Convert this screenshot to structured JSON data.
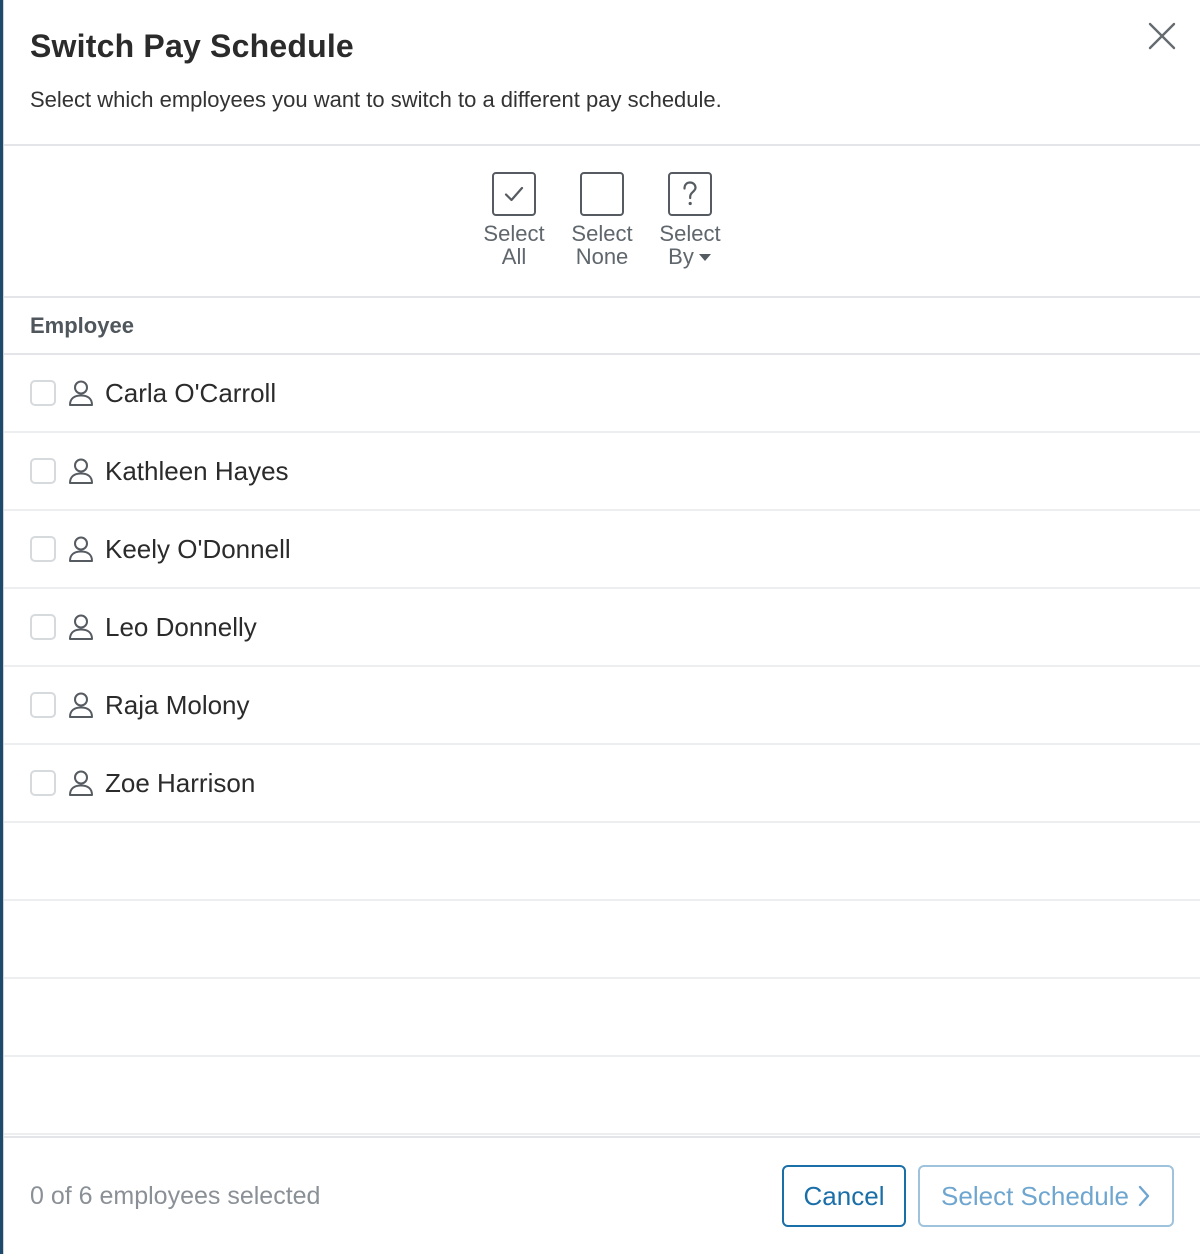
{
  "dialog": {
    "title": "Switch Pay Schedule",
    "subtitle": "Select which employees you want to switch to a different pay schedule."
  },
  "toolbar": {
    "select_all": {
      "line1": "Select",
      "line2": "All",
      "icon": "checkbox-checked-icon"
    },
    "select_none": {
      "line1": "Select",
      "line2": "None",
      "icon": "checkbox-empty-icon"
    },
    "select_by": {
      "line1": "Select",
      "line2": "By",
      "icon": "question-box-icon"
    }
  },
  "table": {
    "column_header": "Employee",
    "rows": [
      {
        "name": "Carla O'Carroll",
        "checked": false
      },
      {
        "name": "Kathleen Hayes",
        "checked": false
      },
      {
        "name": "Keely O'Donnell",
        "checked": false
      },
      {
        "name": "Leo Donnelly",
        "checked": false
      },
      {
        "name": "Raja Molony",
        "checked": false
      },
      {
        "name": "Zoe Harrison",
        "checked": false
      }
    ],
    "empty_rows": 4
  },
  "footer": {
    "selection_count": "0 of 6 employees selected",
    "cancel_label": "Cancel",
    "next_label": "Select Schedule"
  },
  "colors": {
    "primary": "#1b6fa8",
    "primary_disabled": "#6fa6cf",
    "backdrop": "#1d4a6b"
  }
}
